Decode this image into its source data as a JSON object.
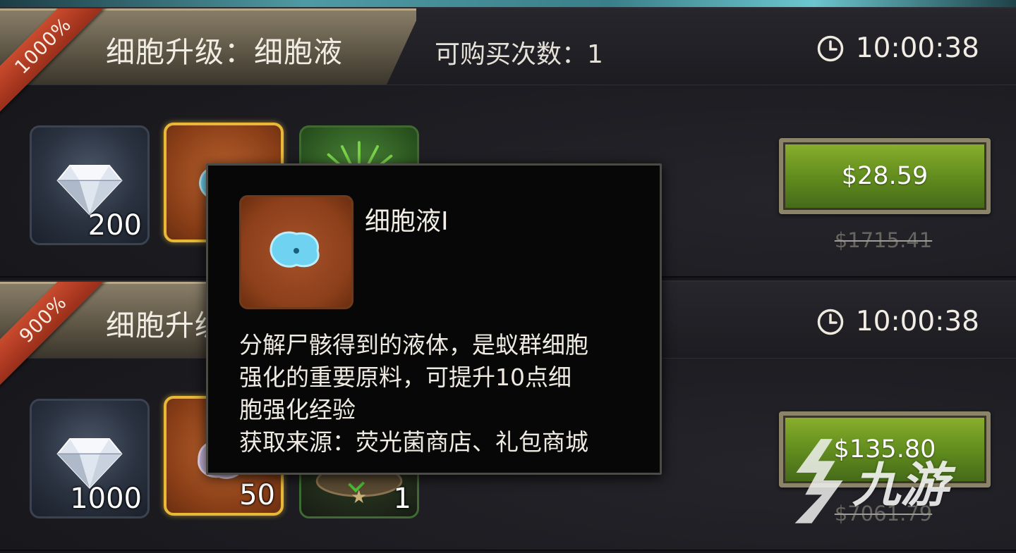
{
  "offers": [
    {
      "badge": "1000%",
      "title": "细胞升级：细胞液",
      "purchase_count_label": "可购买次数：1",
      "timer": "10:00:38",
      "items": [
        {
          "icon": "diamond-icon",
          "qty": "200"
        }
      ],
      "price": "$28.59",
      "original_price": "$1715.41"
    },
    {
      "badge": "900%",
      "title": "细胞升级",
      "timer": "10:00:38",
      "items": [
        {
          "icon": "diamond-icon",
          "qty": "1000"
        },
        {
          "icon": "cell-fluid-icon",
          "qty": "50"
        },
        {
          "icon": "nest-icon",
          "qty": "1"
        }
      ],
      "price": "$135.80",
      "original_price": "$7061.79"
    }
  ],
  "tooltip": {
    "name": "细胞液I",
    "icon": "cell-fluid-icon",
    "description_lines": [
      "分解尸骸得到的液体，是蚁群细胞",
      "强化的重要原料，可提升10点细",
      "胞强化经验",
      "获取来源：荧光菌商店、礼包商城"
    ]
  },
  "watermark": {
    "text": "九游"
  },
  "colors": {
    "buy_button": "#6f9a22",
    "badge": "#b83d24",
    "selected_border": "#e8b838"
  }
}
